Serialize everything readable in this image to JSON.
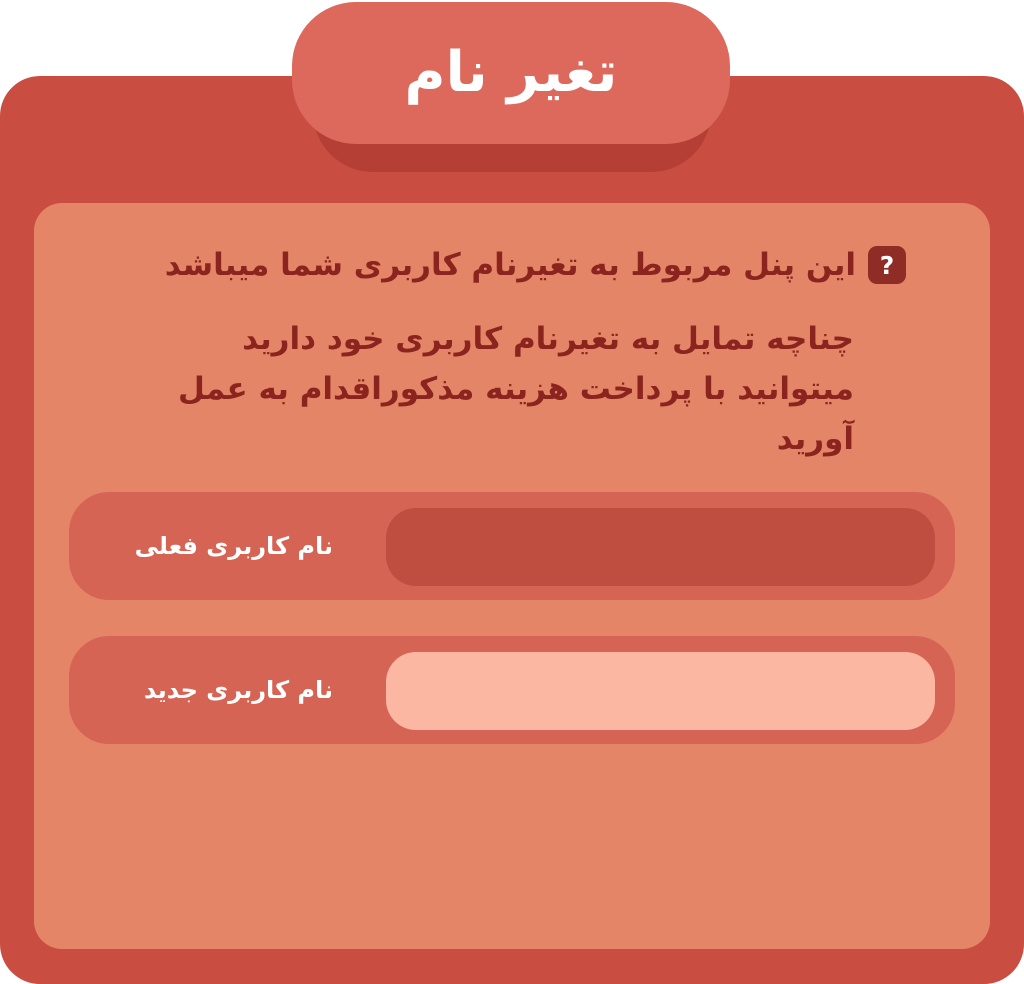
{
  "header": {
    "title": "تغیر نام"
  },
  "info": {
    "icon": "question-icon",
    "icon_glyph": "?",
    "line1": "این پنل مربوط به تغیرنام کاربری شما میباشد",
    "line2": "چناچه تمایل به تغیرنام کاربری خود دارید میتوانید با پرداخت هزینه مذکوراقدام به عمل آورید"
  },
  "fields": {
    "current": {
      "label": "نام کاربری فعلی",
      "value": "",
      "placeholder": ""
    },
    "new": {
      "label": "نام کاربری جدید",
      "value": "",
      "placeholder": ""
    }
  },
  "colors": {
    "outer": "#c94d40",
    "inner": "#e58567",
    "title_tab": "#dc695c",
    "text_dark": "#8b241e",
    "input_dark": "#bf4e40",
    "input_light": "#fbb7a2"
  }
}
